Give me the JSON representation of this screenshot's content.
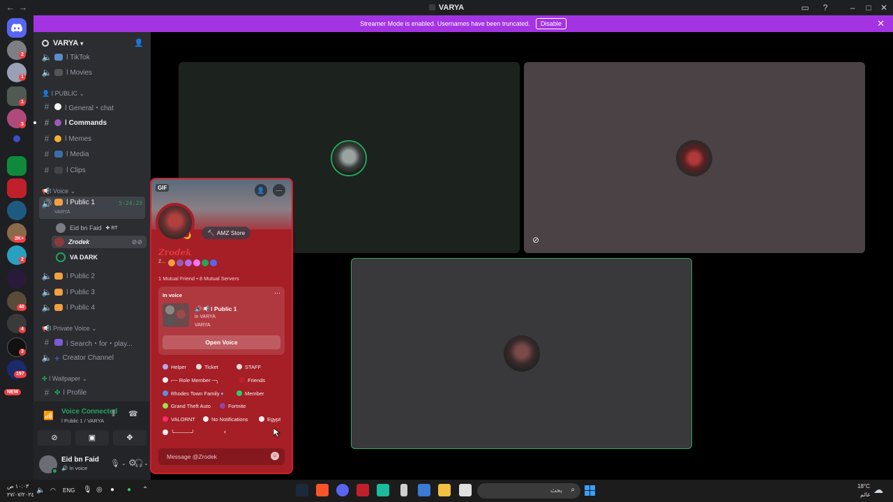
{
  "window": {
    "title": "VARYA"
  },
  "banner": {
    "text": "Streamer Mode is enabled. Usernames have been truncated.",
    "button": "Disable"
  },
  "rail": {
    "badges": [
      "2",
      "1",
      "1",
      "3",
      "2K+",
      "2",
      "40",
      "4",
      "3",
      "197"
    ],
    "new_label": "NEW"
  },
  "server": {
    "name": "VARYA"
  },
  "channels": {
    "tiktok": "ǀ TikTok",
    "movies": "ǀ Movies",
    "public_category": "ǀ PUBLIC",
    "general": "ǀ General・chat",
    "commands": "ǀ Commands",
    "memes": "ǀ Memes",
    "media": "ǀ Media",
    "clips": "ǀ Clips",
    "voice_category": "ǀ Voice",
    "public1": "ǀ Public 1",
    "public1_timer": "5:24:23",
    "public1_server": "VARYA",
    "public2": "ǀ Public 2",
    "public3": "ǀ Public 3",
    "public4": "ǀ Public 4",
    "private_category": "ǀ Private Voice",
    "search": "ǀ Search・for・play...",
    "creator": "Creator Channel",
    "wallpaper_category": "ǀ Wallpaper",
    "profile": "ǀ Profile"
  },
  "voice_users": [
    {
      "name": "Eid bn Faid",
      "tag": "RT"
    },
    {
      "name": "Zrodek"
    },
    {
      "name": "VA DARK"
    }
  ],
  "voice_panel": {
    "status": "Voice Connected",
    "location": "ǀ Public 1 / VARYA"
  },
  "user_panel": {
    "name": "Eid bn Faid",
    "status": "In voice"
  },
  "popout": {
    "gif_badge": "GIF",
    "store_label": "AMZ Store",
    "display_name": "Zrodek",
    "mutuals": "1 Mutual Friend • 8 Mutual Servers",
    "in_voice_label": "In voice",
    "voice_channel": "ǀ Public 1",
    "voice_in": "in VARYA",
    "voice_server": "VARYA",
    "open_voice": "Open Voice",
    "roles": [
      "Helper",
      "Ticket",
      "STAFF",
      "Role Member",
      "Friends",
      "Rhodes Town Family",
      "Member",
      "Grand Theft Auto",
      "Fortnite",
      "VALORNT",
      "No Notifications",
      "Egypt"
    ],
    "message_placeholder": "Message @Zrodek"
  },
  "taskbar": {
    "time": "١٠:٠٣ ص",
    "date": "٢٧/٠٧/٢٠٢٤",
    "lang": "ENG",
    "search_placeholder": "بحث",
    "temp": "18°C",
    "weather": "غائم"
  },
  "colors": {
    "banner": "#a434e2",
    "popout": "#a61e26",
    "accent_green": "#23a55a",
    "speaking": "#3ba55c"
  }
}
